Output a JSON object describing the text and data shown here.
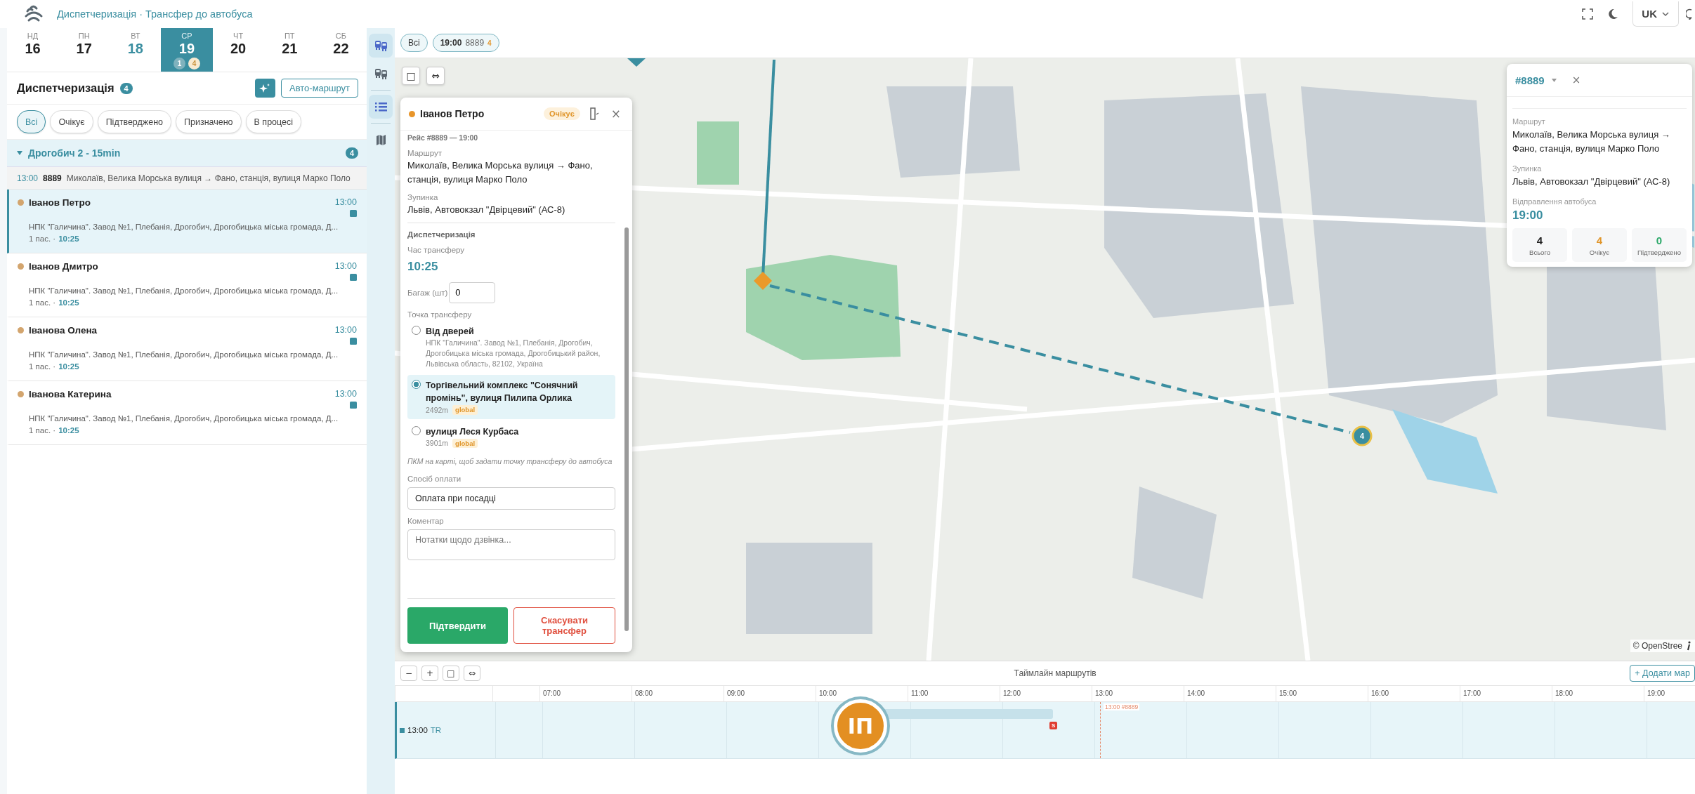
{
  "header": {
    "title": "Диспетчеризація · Трансфер до автобуса",
    "language": "UK"
  },
  "days": [
    {
      "weekday": "НД",
      "day": "16",
      "today": false,
      "selected": false
    },
    {
      "weekday": "ПН",
      "day": "17",
      "today": false,
      "selected": false
    },
    {
      "weekday": "ВТ",
      "day": "18",
      "today": true,
      "selected": false
    },
    {
      "weekday": "СР",
      "day": "19",
      "today": false,
      "selected": true,
      "badges": [
        {
          "text": "1",
          "kind": "assigned"
        },
        {
          "text": "4",
          "kind": "pending"
        }
      ]
    },
    {
      "weekday": "ЧТ",
      "day": "20",
      "today": false,
      "selected": false
    },
    {
      "weekday": "ПТ",
      "day": "21",
      "today": false,
      "selected": false
    },
    {
      "weekday": "СБ",
      "day": "22",
      "today": false,
      "selected": false
    }
  ],
  "dispatch": {
    "title": "Диспетчеризація",
    "count": "4",
    "auto_route_button": "Авто-маршрут",
    "filters": [
      {
        "label": "Всі",
        "selected": true
      },
      {
        "label": "Очікує",
        "selected": false
      },
      {
        "label": "Підтверджено",
        "selected": false
      },
      {
        "label": "Призначено",
        "selected": false
      },
      {
        "label": "В процесі",
        "selected": false
      }
    ],
    "group": {
      "name": "Дрогобич 2 - 15min",
      "count": "4",
      "expanded": true
    },
    "trip": {
      "time": "13:00",
      "number": "8889",
      "route": "Миколаїв, Велика Морська вулиця → Фано, станція, вулиця Марко Поло"
    },
    "passengers": [
      {
        "name": "Іванов Петро",
        "time": "13:00",
        "address": "НПК \"Галичина\". Завод №1, Плебанія, Дрогобич, Дрогобицька міська громада, Д...",
        "pax": "1 пас. ·",
        "transfer_time": "10:25",
        "selected": true
      },
      {
        "name": "Іванов Дмитро",
        "time": "13:00",
        "address": "НПК \"Галичина\". Завод №1, Плебанія, Дрогобич, Дрогобицька міська громада, Д...",
        "pax": "1 пас. ·",
        "transfer_time": "10:25",
        "selected": false
      },
      {
        "name": "Іванова Олена",
        "time": "13:00",
        "address": "НПК \"Галичина\". Завод №1, Плебанія, Дрогобич, Дрогобицька міська громада, Д...",
        "pax": "1 пас. ·",
        "transfer_time": "10:25",
        "selected": false
      },
      {
        "name": "Іванова Катерина",
        "time": "13:00",
        "address": "НПК \"Галичина\". Завод №1, Плебанія, Дрогобич, Дрогобицька міська громада, Д...",
        "pax": "1 пас. ·",
        "transfer_time": "10:25",
        "selected": false
      }
    ]
  },
  "rail": [
    {
      "kind": "bus",
      "selected": true
    },
    {
      "kind": "bus",
      "selected": false
    },
    {
      "kind": "list",
      "selected": true
    },
    {
      "kind": "map",
      "selected": false
    }
  ],
  "trip_chips": [
    {
      "kind": "all",
      "label": "Всі"
    },
    {
      "kind": "trip",
      "time": "19:00",
      "number": "8889",
      "count": "4"
    }
  ],
  "map": {
    "controls": [
      "□",
      "⇔"
    ],
    "cluster_count": "4",
    "attribution": "© OpenStree"
  },
  "dialog": {
    "name": "Іванов Петро",
    "status": "Очікує",
    "close": "×",
    "trip_line": "Рейс #8889 — 19:00",
    "route_label": "Маршрут",
    "route": "Миколаїв, Велика Морська вулиця → Фано, станція, вулиця Марко Поло",
    "stop_label": "Зупинка",
    "stop": "Львів, Автовокзал \"Двірцевий\" (АС-8)",
    "section": "Диспетчеризація",
    "time_label": "Час трансферу",
    "time": "10:25",
    "baggage_label": "Багаж (шт)",
    "baggage": "0",
    "point_label": "Точка трансферу",
    "points": [
      {
        "title": "Від дверей",
        "detail": "НПК \"Галичина\". Завод №1, Плебанія, Дрогобич, Дрогобицька міська громада, Дрогобицький район, Львівська область, 82102, Україна",
        "selected": false
      },
      {
        "title": "Торгівельний комплекс \"Сонячний промінь\", вулиця Пилипа Орлика",
        "detail": "2492m",
        "tag": "global",
        "selected": true
      },
      {
        "title": "вулиця Леся Курбаса",
        "detail": "3901m",
        "tag": "global",
        "selected": false
      }
    ],
    "hint": "ПКМ на карті, щоб задати точку трансферу до автобуса",
    "payment_label": "Спосіб оплати",
    "payment": "Оплата при посадці",
    "comment_label": "Коментар",
    "comment_placeholder": "Нотатки щодо дзвінка...",
    "confirm": "Підтвердити",
    "cancel": "Скасувати трансфер"
  },
  "trip_card": {
    "number": "#8889",
    "close": "×",
    "route_label": "Маршрут",
    "route": "Миколаїв, Велика Морська вулиця → Фано, станція, вулиця Марко Поло",
    "stop_label": "Зупинка",
    "stop": "Львів, Автовокзал \"Двірцевий\" (АС-8)",
    "departure_label": "Відправлення автобуса",
    "departure": "19:00",
    "stats": [
      {
        "kind": "total",
        "value": "4",
        "label": "Всього"
      },
      {
        "kind": "pending",
        "value": "4",
        "label": "Очікує"
      },
      {
        "kind": "confirmed",
        "value": "0",
        "label": "Підтверджено"
      }
    ]
  },
  "timeline": {
    "controls": [
      "−",
      "+",
      "□",
      "⇔"
    ],
    "title": "Таймлайн маршрутів",
    "add_button": "+ Додати мар",
    "hours": [
      "07:00",
      "08:00",
      "09:00",
      "10:00",
      "11:00",
      "12:00",
      "13:00",
      "14:00",
      "15:00",
      "16:00",
      "17:00",
      "18:00",
      "19:00"
    ],
    "lane": {
      "time": "13:00",
      "code": "TR",
      "avatar": "ІП",
      "stop_marker": "S",
      "now_label": "13:00 #8889"
    }
  }
}
